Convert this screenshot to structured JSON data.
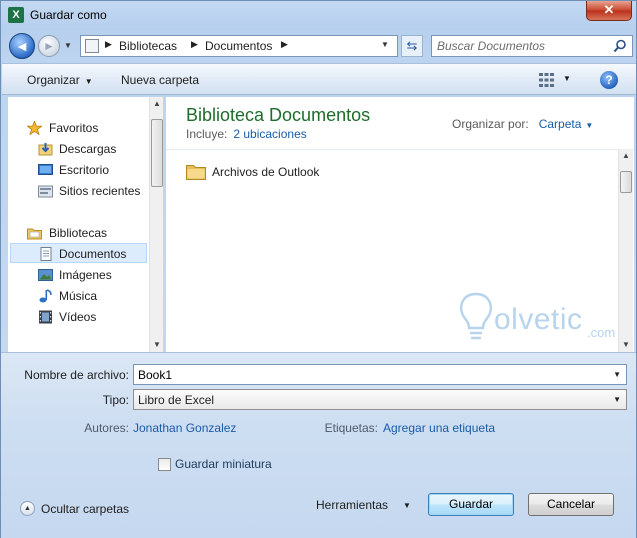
{
  "window": {
    "title": "Guardar como",
    "app_icon_letter": "X",
    "close_glyph": "✕"
  },
  "address": {
    "breadcrumbs": [
      "Bibliotecas",
      "Documentos"
    ],
    "search_placeholder": "Buscar Documentos"
  },
  "toolbar": {
    "organize_label": "Organizar",
    "new_folder_label": "Nueva carpeta",
    "help_glyph": "?"
  },
  "nav": {
    "items": [
      {
        "label": "Favoritos",
        "icon": "star-icon",
        "section": true
      },
      {
        "label": "Descargas",
        "icon": "downloads-icon"
      },
      {
        "label": "Escritorio",
        "icon": "desktop-icon"
      },
      {
        "label": "Sitios recientes",
        "icon": "recent-places-icon"
      },
      {
        "label": "Bibliotecas",
        "icon": "libraries-icon",
        "section": true
      },
      {
        "label": "Documentos",
        "icon": "documents-icon",
        "selected": true
      },
      {
        "label": "Imágenes",
        "icon": "pictures-icon"
      },
      {
        "label": "Música",
        "icon": "music-icon"
      },
      {
        "label": "Vídeos",
        "icon": "videos-icon"
      }
    ]
  },
  "content": {
    "library_title": "Biblioteca Documentos",
    "includes_label": "Incluye:",
    "includes_link": "2 ubicaciones",
    "arrange_label": "Organizar por:",
    "arrange_value": "Carpeta",
    "files": [
      {
        "name": "Archivos de Outlook",
        "icon": "folder-icon"
      }
    ]
  },
  "watermark": {
    "text": "olvetic",
    "suffix": ".com"
  },
  "form": {
    "filename_label": "Nombre de archivo:",
    "filename_value": "Book1",
    "type_label": "Tipo:",
    "type_value": "Libro de Excel",
    "authors_label": "Autores:",
    "authors_value": "Jonathan Gonzalez",
    "tags_label": "Etiquetas:",
    "tags_value": "Agregar una etiqueta",
    "thumbnail_label": "Guardar miniatura",
    "thumbnail_checked": false,
    "hide_folders_label": "Ocultar carpetas",
    "tools_label": "Herramientas",
    "save_label": "Guardar",
    "cancel_label": "Cancelar"
  }
}
